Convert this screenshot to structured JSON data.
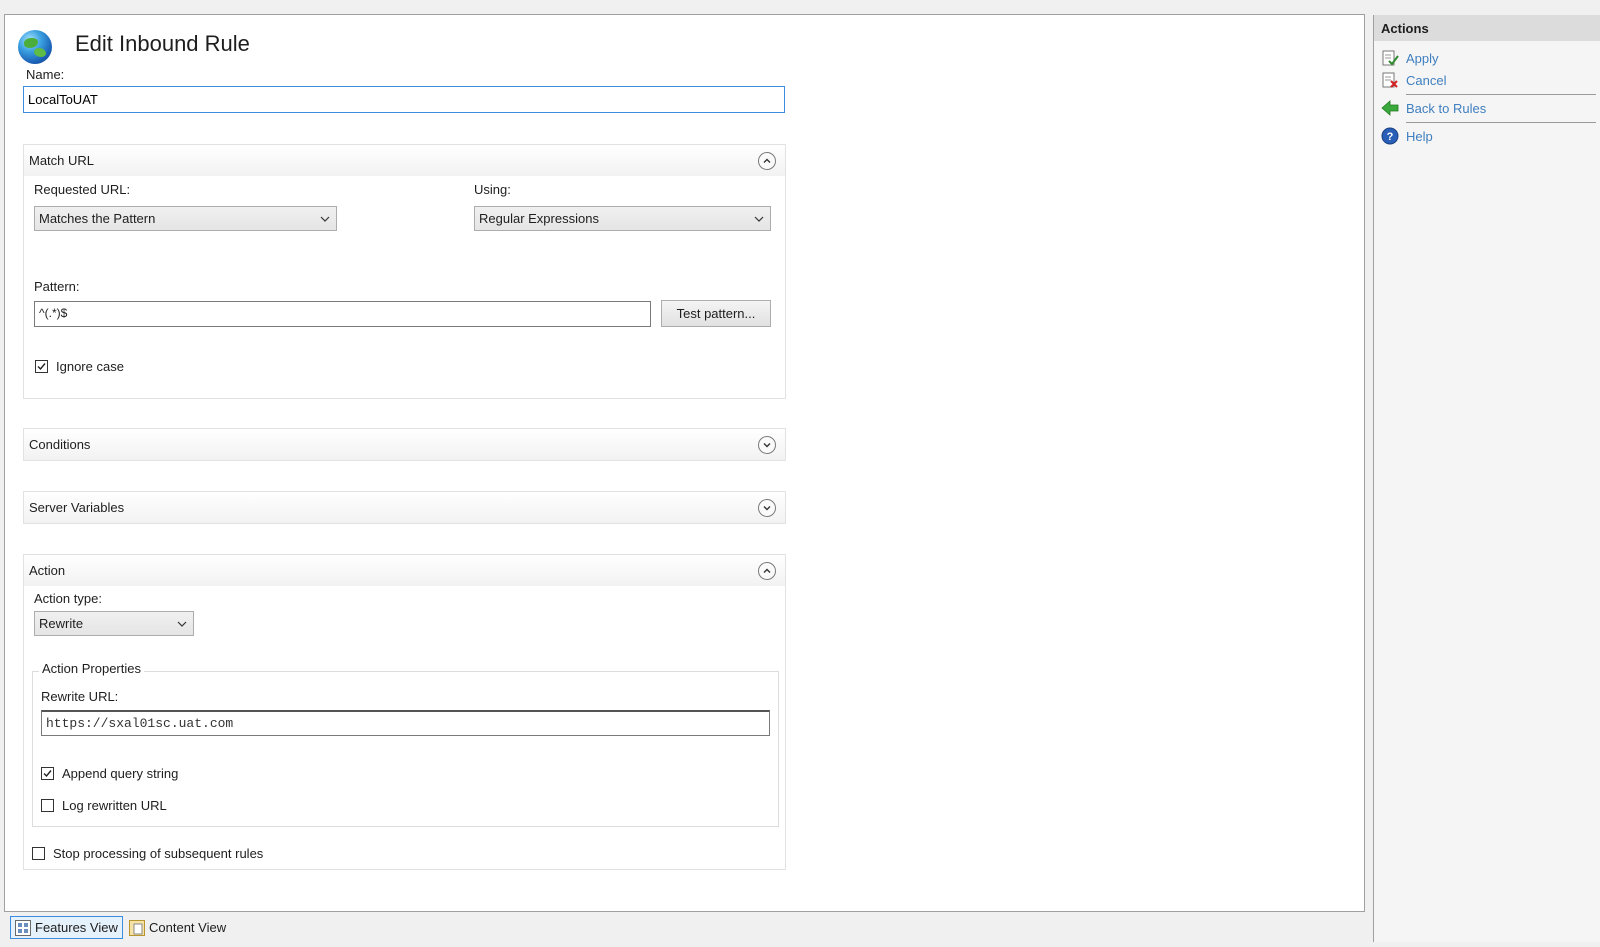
{
  "page": {
    "title": "Edit Inbound Rule"
  },
  "name_field": {
    "label": "Name:",
    "value": "LocalToUAT"
  },
  "match_url": {
    "title": "Match URL",
    "requested_url_label": "Requested URL:",
    "requested_url_value": "Matches the Pattern",
    "using_label": "Using:",
    "using_value": "Regular Expressions",
    "pattern_label": "Pattern:",
    "pattern_value": "^(.*)$",
    "test_pattern_button": "Test pattern...",
    "ignore_case_label": "Ignore case",
    "ignore_case_checked": true
  },
  "conditions": {
    "title": "Conditions"
  },
  "server_variables": {
    "title": "Server Variables"
  },
  "action": {
    "title": "Action",
    "action_type_label": "Action type:",
    "action_type_value": "Rewrite",
    "properties_legend": "Action Properties",
    "rewrite_url_label": "Rewrite URL:",
    "rewrite_url_value": "https://sxal01sc.uat.com",
    "append_query_label": "Append query string",
    "append_query_checked": true,
    "log_rewritten_label": "Log rewritten URL",
    "log_rewritten_checked": false,
    "stop_processing_label": "Stop processing of subsequent rules",
    "stop_processing_checked": false
  },
  "bottom_tabs": {
    "features_view": "Features View",
    "content_view": "Content View"
  },
  "actions_pane": {
    "title": "Actions",
    "apply": "Apply",
    "cancel": "Cancel",
    "back_to_rules": "Back to Rules",
    "help": "Help"
  }
}
